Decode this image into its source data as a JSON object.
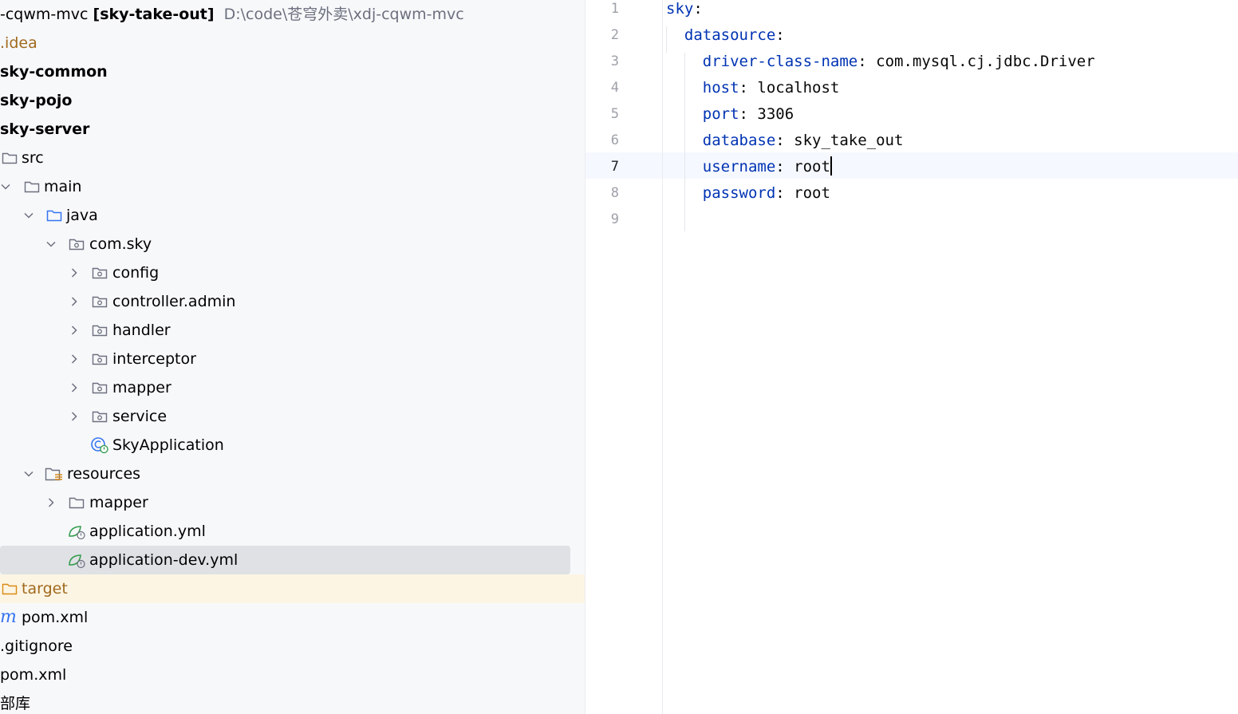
{
  "project_tree": {
    "root": {
      "name": "-cqwm-mvc",
      "module": "[sky-take-out]",
      "path": "D:\\code\\苍穹外卖\\xdj-cqwm-mvc"
    },
    "items": [
      {
        "label": "idea",
        "kind": "plain-folder"
      },
      {
        "label": "sky-common",
        "kind": "module"
      },
      {
        "label": "sky-pojo",
        "kind": "module"
      },
      {
        "label": "sky-server",
        "kind": "module"
      },
      {
        "label": "src",
        "kind": "folder"
      },
      {
        "label": "main",
        "kind": "folder"
      },
      {
        "label": "java",
        "kind": "source-folder"
      },
      {
        "label": "com.sky",
        "kind": "package"
      },
      {
        "label": "config",
        "kind": "package"
      },
      {
        "label": "controller.admin",
        "kind": "package"
      },
      {
        "label": "handler",
        "kind": "package"
      },
      {
        "label": "interceptor",
        "kind": "package"
      },
      {
        "label": "mapper",
        "kind": "package"
      },
      {
        "label": "service",
        "kind": "package"
      },
      {
        "label": "SkyApplication",
        "kind": "spring-class"
      },
      {
        "label": "resources",
        "kind": "resources-folder"
      },
      {
        "label": "mapper",
        "kind": "folder"
      },
      {
        "label": "application.yml",
        "kind": "yaml-file"
      },
      {
        "label": "application-dev.yml",
        "kind": "yaml-file",
        "selected": true
      },
      {
        "label": "target",
        "kind": "excluded-folder"
      },
      {
        "label": "pom.xml",
        "kind": "maven-file"
      },
      {
        "label": ".gitignore",
        "kind": "file"
      },
      {
        "label": "pom.xml",
        "kind": "file"
      },
      {
        "label": "部库",
        "kind": "file"
      }
    ]
  },
  "editor": {
    "current_line": 7,
    "lines": [
      {
        "n": "1",
        "key": "sky",
        "value": ""
      },
      {
        "n": "2",
        "key": "datasource",
        "value": ""
      },
      {
        "n": "3",
        "key": "driver-class-name",
        "value": "com.mysql.cj.jdbc.Driver"
      },
      {
        "n": "4",
        "key": "host",
        "value": "localhost"
      },
      {
        "n": "5",
        "key": "port",
        "value": "3306"
      },
      {
        "n": "6",
        "key": "database",
        "value": "sky_take_out"
      },
      {
        "n": "7",
        "key": "username",
        "value": "root"
      },
      {
        "n": "8",
        "key": "password",
        "value": "root"
      },
      {
        "n": "9",
        "key": "",
        "value": ""
      }
    ]
  },
  "colors": {
    "key": "#0033b3",
    "selection": "#dfe1e5",
    "excluded": "#fdf5e4",
    "spring": "#2f9a48",
    "folder": "#6c707e",
    "source": "#3574f0",
    "orange": "#d98a16"
  }
}
